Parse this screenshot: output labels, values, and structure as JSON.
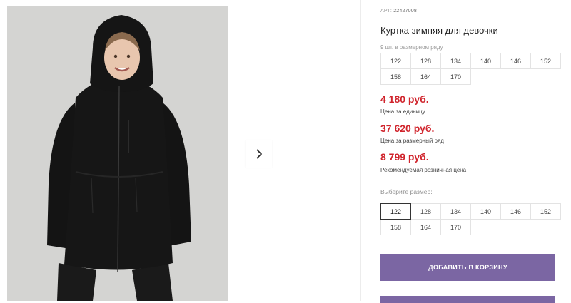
{
  "product": {
    "article_label": "АРТ:",
    "article_number": "22427008",
    "title": "Куртка зимняя для девочки",
    "pack_caption": "9 шт. в размерном ряду",
    "pack_sizes": [
      "122",
      "128",
      "134",
      "140",
      "146",
      "152",
      "158",
      "164",
      "170"
    ]
  },
  "prices": {
    "unit_price": "4 180 руб.",
    "unit_label": "Цена за единицу",
    "pack_price": "37 620 руб.",
    "pack_label": "Цена за размерный ряд",
    "retail_price": "8 799 руб.",
    "retail_label": "Рекомендуемая розничная цена"
  },
  "size_select": {
    "caption": "Выберите размер:",
    "sizes": [
      "122",
      "128",
      "134",
      "140",
      "146",
      "152",
      "158",
      "164",
      "170"
    ],
    "selected": "122"
  },
  "actions": {
    "add_to_cart_label": "ДОБАВИТЬ В КОРЗИНУ"
  },
  "gallery": {
    "next_icon": "chevron-right-icon"
  },
  "colors": {
    "price": "#d0242c",
    "button": "#7b66a3",
    "photo_bg": "#d4d4d2",
    "jacket": "#161616"
  }
}
